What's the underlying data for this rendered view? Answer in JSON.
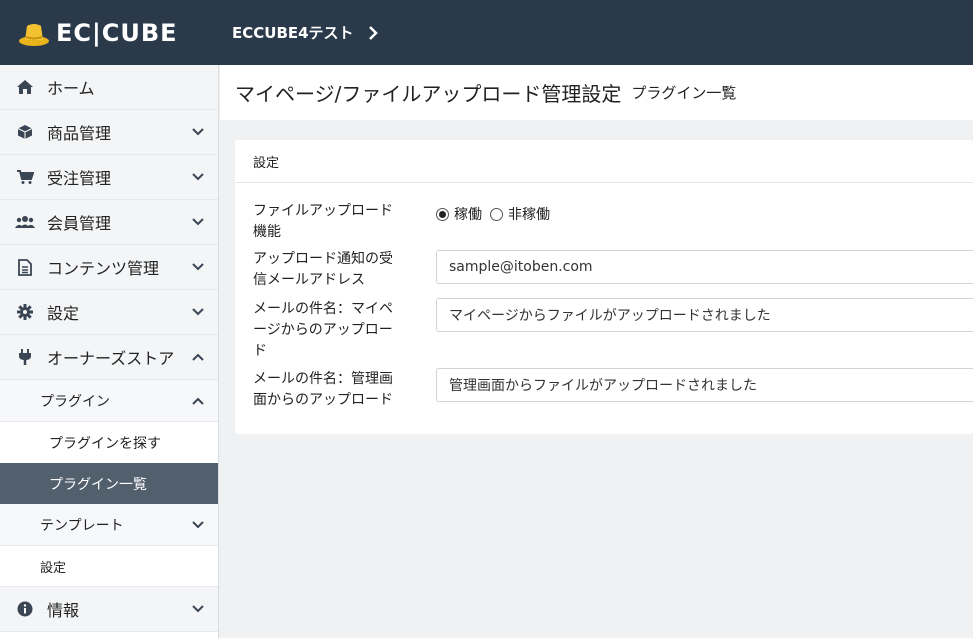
{
  "header": {
    "logo_text": "EC|CUBE",
    "shop_name": "ECCUBE4テスト"
  },
  "sidebar": {
    "items": [
      {
        "label": "ホーム",
        "icon": "home-icon"
      },
      {
        "label": "商品管理",
        "icon": "cube-icon"
      },
      {
        "label": "受注管理",
        "icon": "cart-icon"
      },
      {
        "label": "会員管理",
        "icon": "users-icon"
      },
      {
        "label": "コンテンツ管理",
        "icon": "file-icon"
      },
      {
        "label": "設定",
        "icon": "gear-icon"
      },
      {
        "label": "オーナーズストア",
        "icon": "plug-icon"
      }
    ],
    "owners_store_sub": {
      "plugin_label": "プラグイン",
      "plugin_children": [
        "プラグインを探す",
        "プラグイン一覧"
      ],
      "template_label": "テンプレート",
      "settings_label": "設定"
    },
    "info_label": "情報",
    "info_icon": "info-icon"
  },
  "main": {
    "title": "マイページ/ファイルアップロード管理設定",
    "subtitle": "プラグイン一覧",
    "card": {
      "header": "設定",
      "function_label": "ファイルアップロード機能",
      "radio_on": "稼働",
      "radio_off": "非稼働",
      "email_label": "アップロード通知の受信メールアドレス",
      "email_value": "sample@itoben.com",
      "subject_mypage_label": "メールの件名：マイページからのアップロード",
      "subject_mypage_value": "マイページからファイルがアップロードされました",
      "subject_admin_label": "メールの件名：管理画面からのアップロード",
      "subject_admin_value": "管理画面からファイルがアップロードされました"
    }
  },
  "colors": {
    "header_bg": "#2b3a4a",
    "active_bg": "#525f6d",
    "logo_gold": "#e8b41a"
  }
}
